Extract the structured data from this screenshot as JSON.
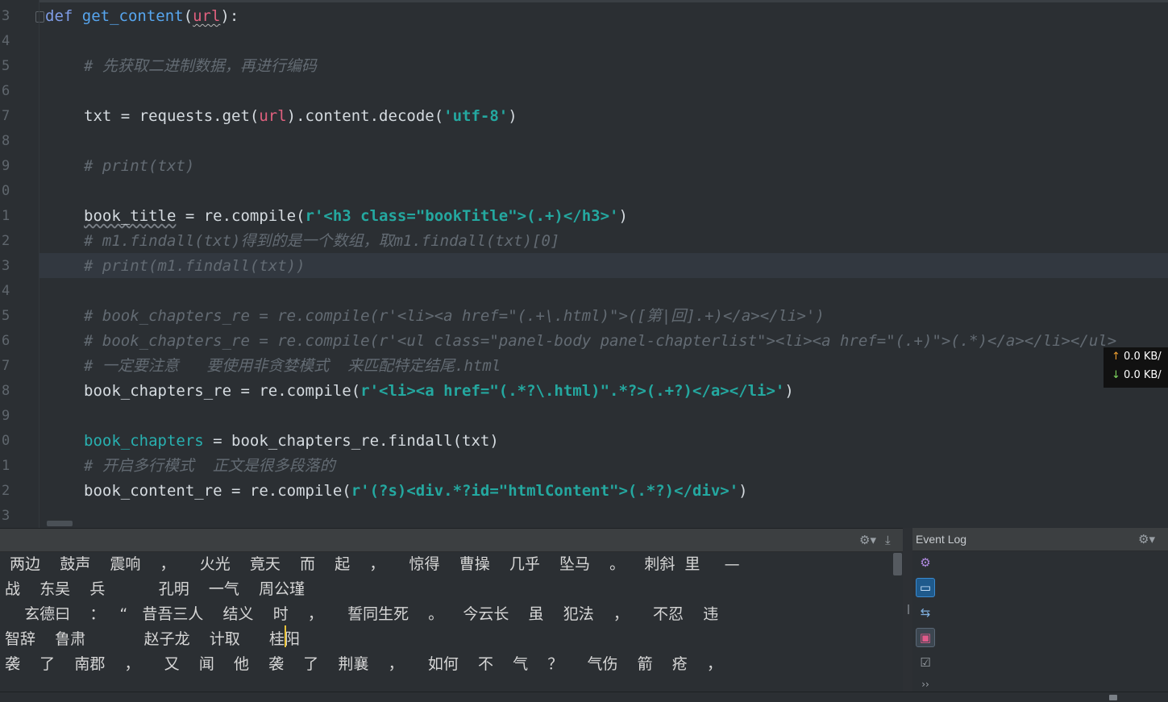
{
  "editor": {
    "line_numbers": [
      "3",
      "4",
      "5",
      "6",
      "7",
      "8",
      "9",
      "0",
      "1",
      "2",
      "3",
      "4",
      "5",
      "6",
      "7",
      "8",
      "9",
      "0",
      "1",
      "2",
      "3"
    ],
    "lines": {
      "l1_kw": "def",
      "l1_fn": "get_content",
      "l1_open": "(",
      "l1_param": "url",
      "l1_close": "):",
      "c1": "# 先获取二进制数据，再进行编码",
      "l3_a": "txt = requests.get(",
      "l3_param": "url",
      "l3_b": ").content.decode(",
      "l3_str": "'utf-8'",
      "l3_c": ")",
      "c2": "# print(txt)",
      "l5_var": "book_title",
      "l5_a": " = re.compile(",
      "l5_str": "r'<h3 class=\"bookTitle\">(.+)</h3>'",
      "l5_b": ")",
      "c3": "# m1.findall(txt)得到的是一个数组，取m1.findall(txt)[0]",
      "c4": "# print(m1.findall(txt))",
      "c5": "# book_chapters_re = re.compile(r'<li><a href=\"(.+\\.html)\">([第|回].+)</a></li>')",
      "c6": "# book_chapters_re = re.compile(r'<ul class=\"panel-body panel-chapterlist\"><li><a href=\"(.+)\">(.*)</a></li></ul>",
      "c7": "# 一定要注意   要使用非贪婪模式  来匹配特定结尾.html",
      "l12_a": "book_chapters_re = re.compile(",
      "l12_str": "r'<li><a href=\"(.*?\\.html)\".*?>(.+?)</a></li>'",
      "l12_b": ")",
      "l14_var": "book_chapters",
      "l14_a": " = book_chapters_re.findall(txt)",
      "c8": "# 开启多行模式  正文是很多段落的",
      "l16_a": "book_content_re = re.compile(",
      "l16_str": "r'(?s)<div.*?id=\"htmlContent\">(.*?)</div>'",
      "l16_b": ")"
    }
  },
  "net_speed": {
    "up_arrow": "↑",
    "up": "0.0 KB/",
    "down_arrow": "↓",
    "down": "0.0 KB/"
  },
  "run_output": {
    "lines": [
      " 两边    鼓声    震响    ，     火光    竟天    而    起    ，     惊得    曹操    几乎    坠马    。    刺斜  里     —",
      "战    东吴    兵           孔明    一气    周公瑾",
      "    玄德曰    ：   “   昔吾三人    结义    时    ，     誓同生死    。    今云长    虽    犯法    ，     不忍    违",
      "智辞    鲁肃            赵子龙    计取      桂阳",
      "袭    了    南郡    ，     又    闻    他    袭    了    荆襄    ，     如何    不    气    ？     气伤    箭    疮    ，"
    ],
    "settings_icon": "gear-icon",
    "pin_icon": "download-icon"
  },
  "event_log": {
    "title": "Event Log",
    "more": "››"
  },
  "colors": {
    "background": "#2b2f33",
    "keyword": "#7f9de8",
    "function": "#57a6ef",
    "param": "#e0607e",
    "string": "#24a8a0",
    "comment": "#636b73"
  }
}
